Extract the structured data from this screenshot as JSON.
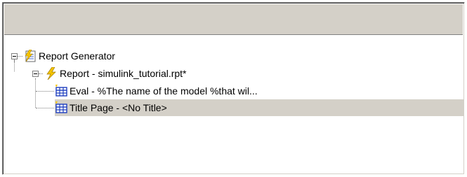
{
  "tree": {
    "root": {
      "label": "Report Generator",
      "icon": "report-generator-icon",
      "expanded": true
    },
    "report": {
      "label": "Report - simulink_tutorial.rpt*",
      "icon": "lightning-bolt-icon",
      "expanded": true
    },
    "children": [
      {
        "label": "Eval - %The name of the model %that wil...",
        "icon": "table-component-icon",
        "selected": false
      },
      {
        "label": "Title Page - <No Title>",
        "icon": "table-component-icon",
        "selected": true
      }
    ]
  },
  "colors": {
    "selection": "#d4d0c8",
    "header": "#d4d0c8",
    "bolt": "#f5c400",
    "table_icon": "#1f3fbf"
  }
}
